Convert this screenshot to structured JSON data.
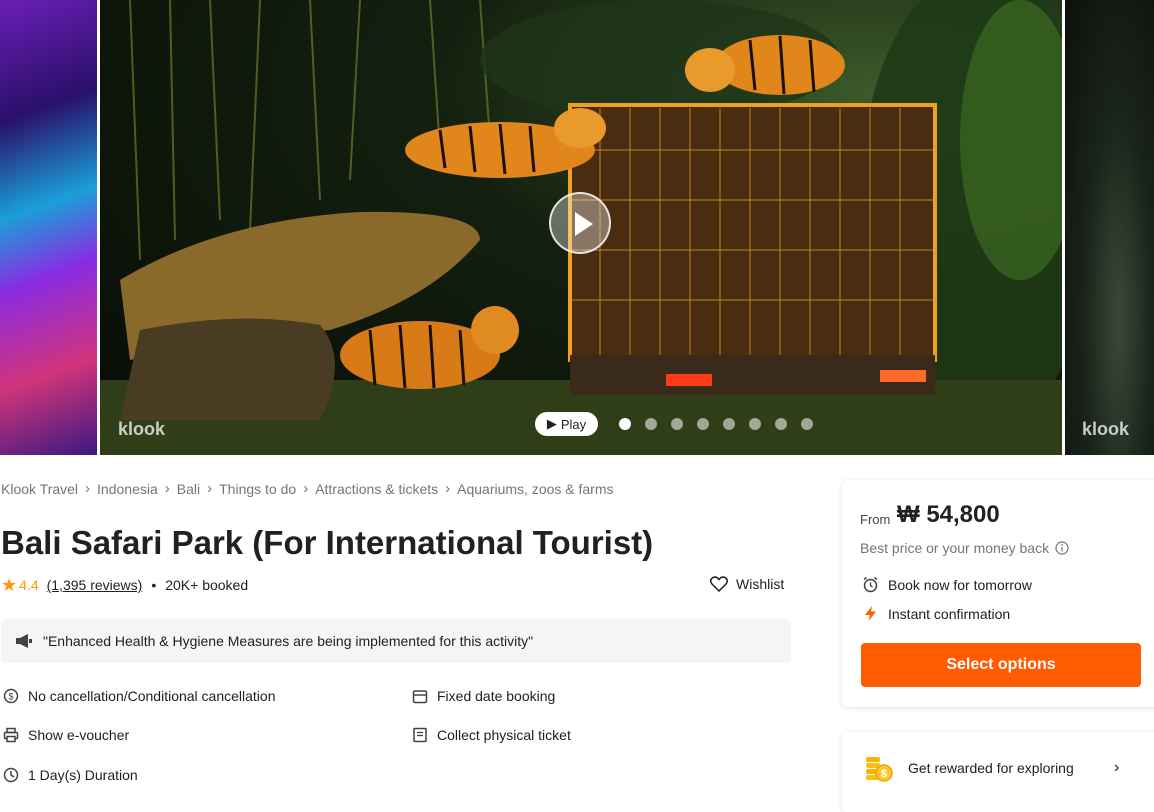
{
  "gallery": {
    "watermark": "klook",
    "play_label": "Play",
    "slide_count": 8,
    "active_slide": 1
  },
  "breadcrumb": [
    "Klook Travel",
    "Indonesia",
    "Bali",
    "Things to do",
    "Attractions & tickets",
    "Aquariums, zoos & farms"
  ],
  "activity": {
    "title": "Bali Safari Park (For International Tourist)",
    "rating": "4.4",
    "reviews": "(1,395 reviews)",
    "booked": "20K+ booked",
    "wishlist_label": "Wishlist",
    "notice": "\"Enhanced Health & Hygiene Measures are being implemented for this activity\"",
    "features": [
      {
        "icon": "coin-icon",
        "label": "No cancellation/Conditional cancellation"
      },
      {
        "icon": "calendar-icon",
        "label": "Fixed date booking"
      },
      {
        "icon": "printer-icon",
        "label": "Show e-voucher"
      },
      {
        "icon": "ticket-icon",
        "label": "Collect physical ticket"
      },
      {
        "icon": "clock-icon",
        "label": "1 Day(s) Duration"
      }
    ]
  },
  "booking": {
    "from_label": "From",
    "price": "₩ 54,800",
    "guarantee": "Best price or your money back",
    "availability": "Book now for tomorrow",
    "confirmation": "Instant confirmation",
    "cta": "Select options"
  },
  "rewards": {
    "label": "Get rewarded for exploring"
  },
  "colors": {
    "accent": "#ff5b00",
    "rating": "#ff9900"
  }
}
